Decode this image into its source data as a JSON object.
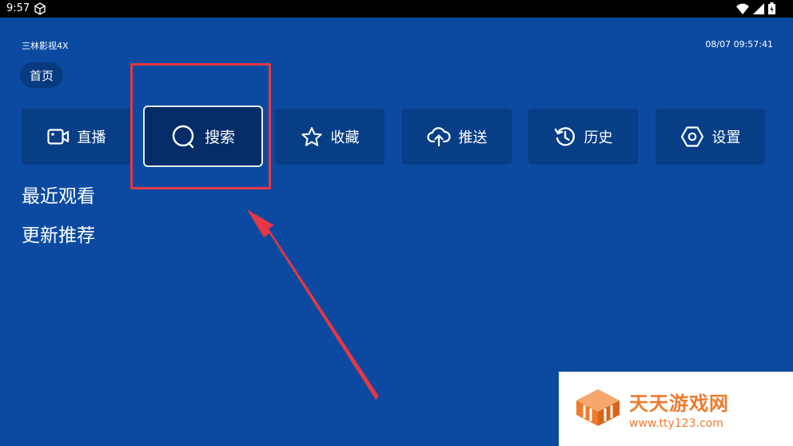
{
  "status_bar": {
    "time": "9:57"
  },
  "app": {
    "title": "三林影视4X",
    "clock": "08/07 09:57:41"
  },
  "nav": {
    "home_label": "首页"
  },
  "menu": [
    {
      "label": "直播",
      "icon": "video-camera-icon"
    },
    {
      "label": "搜索",
      "icon": "search-icon",
      "selected": true
    },
    {
      "label": "收藏",
      "icon": "star-icon"
    },
    {
      "label": "推送",
      "icon": "cloud-upload-icon"
    },
    {
      "label": "历史",
      "icon": "history-icon"
    },
    {
      "label": "设置",
      "icon": "hexagon-settings-icon"
    }
  ],
  "sections": {
    "recent": "最近观看",
    "updates": "更新推荐"
  },
  "annotation": {
    "color": "#e63744"
  },
  "watermark": {
    "name": "天天游戏网",
    "url": "www.tty123.com",
    "color": "#ef7a2e"
  },
  "colors": {
    "background": "#0b4aa0",
    "button": "#083e86",
    "selected_button": "#062d68"
  }
}
